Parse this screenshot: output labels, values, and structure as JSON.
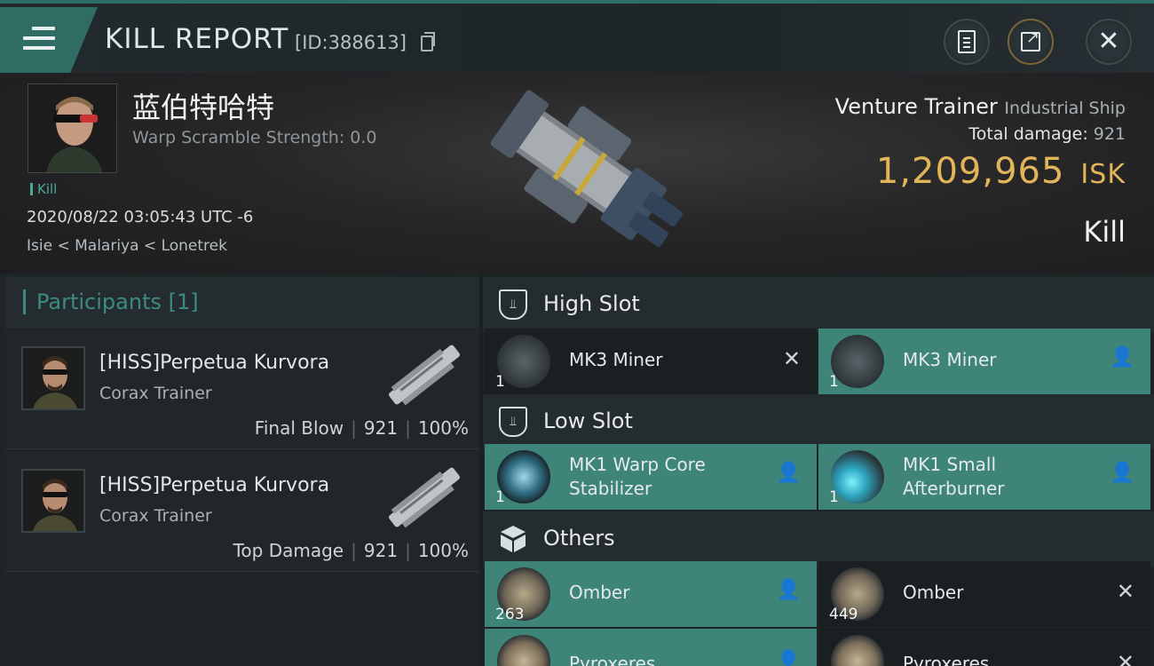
{
  "header": {
    "title": "KILL REPORT",
    "report_id": "[ID:388613]"
  },
  "victim": {
    "name": "蓝伯特哈特",
    "warp_scramble": "Warp Scramble Strength: 0.0",
    "tag": "Kill",
    "datetime": "2020/08/22 03:05:43 UTC -6",
    "location": "Isie < Malariya < Lonetrek",
    "ship_name": "Venture Trainer",
    "ship_class": "Industrial Ship",
    "total_damage_label": "Total damage:",
    "total_damage": "921",
    "isk_value": "1,209,965",
    "isk_unit": "ISK",
    "result": "Kill"
  },
  "participants": {
    "title": "Participants [1]",
    "list": [
      {
        "name": "[HISS]Perpetua Kurvora",
        "ship": "Corax Trainer",
        "role": "Final Blow",
        "damage": "921",
        "percent": "100%"
      },
      {
        "name": "[HISS]Perpetua Kurvora",
        "ship": "Corax Trainer",
        "role": "Top Damage",
        "damage": "921",
        "percent": "100%"
      }
    ]
  },
  "fitting": {
    "high_slot": {
      "title": "High Slot",
      "items": [
        {
          "name": "MK3 Miner",
          "qty": "1",
          "status": "destroyed"
        },
        {
          "name": "MK3 Miner",
          "qty": "1",
          "status": "dropped"
        }
      ]
    },
    "low_slot": {
      "title": "Low Slot",
      "items": [
        {
          "name_line1": "MK1 Warp Core",
          "name_line2": "Stabilizer",
          "qty": "1",
          "status": "dropped"
        },
        {
          "name_line1": "MK1 Small",
          "name_line2": "Afterburner",
          "qty": "1",
          "status": "dropped"
        }
      ]
    },
    "others": {
      "title": "Others",
      "items": [
        {
          "name": "Omber",
          "qty": "263",
          "status": "dropped"
        },
        {
          "name": "Omber",
          "qty": "449",
          "status": "destroyed"
        },
        {
          "name": "Pyroxeres",
          "qty": "",
          "status": "dropped"
        },
        {
          "name": "Pyroxeres",
          "qty": "",
          "status": "destroyed"
        }
      ]
    }
  },
  "colors": {
    "accent_teal": "#3f8479",
    "isk_gold": "#e3b55a",
    "background": "#1b2024"
  },
  "icons": {
    "menu": "hamburger-icon",
    "copy": "copy-icon",
    "clipboard": "clipboard-icon",
    "share": "share-icon",
    "close": "close-icon",
    "dropped": "person-icon",
    "destroyed": "x-icon"
  }
}
